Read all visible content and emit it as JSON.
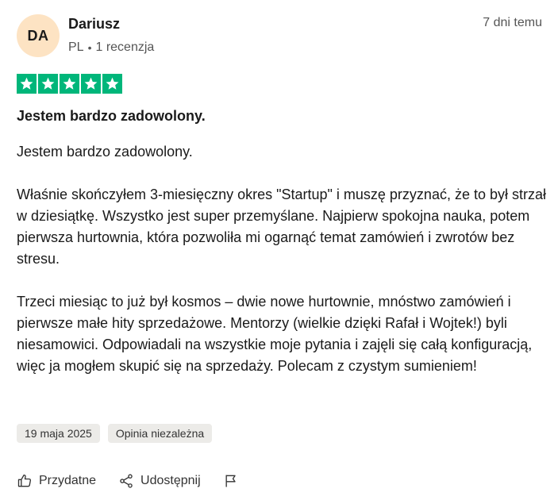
{
  "reviewer": {
    "initials": "DA",
    "name": "Dariusz",
    "country": "PL",
    "separator": "•",
    "review_count": "1 recenzja",
    "avatar_color": "#fde3c3"
  },
  "posted": "7 dni temu",
  "rating": {
    "stars": 5,
    "max": 5,
    "color": "#00b67a"
  },
  "review": {
    "title": "Jestem bardzo zadowolony.",
    "paragraphs": [
      "Jestem bardzo zadowolony.",
      "Właśnie skończyłem 3-miesięczny okres \"Startup\" i muszę przyznać, że to był strzał w dziesiątkę. Wszystko jest super przemyślane. Najpierw spokojna nauka, potem pierwsza hurtownia, która pozwoliła mi ogarnąć temat zamówień i zwrotów bez stresu.",
      "Trzeci miesiąc to już był kosmos – dwie nowe hurtownie, mnóstwo zamówień i pierwsze małe hity sprzedażowe. Mentorzy (wielkie dzięki Rafał i Wojtek!) byli niesamowici. Odpowiadali na wszystkie moje pytania i zajęli się całą konfiguracją, więc ja mogłem skupić się na sprzedaży. Polecam z czystym sumieniem!"
    ]
  },
  "tags": {
    "date": "19 maja 2025",
    "label": "Opinia niezależna"
  },
  "actions": {
    "helpful": {
      "label": "Przydatne",
      "icon": "thumbs-up-icon"
    },
    "share": {
      "label": "Udostępnij",
      "icon": "share-icon"
    },
    "flag": {
      "icon": "flag-icon"
    }
  }
}
